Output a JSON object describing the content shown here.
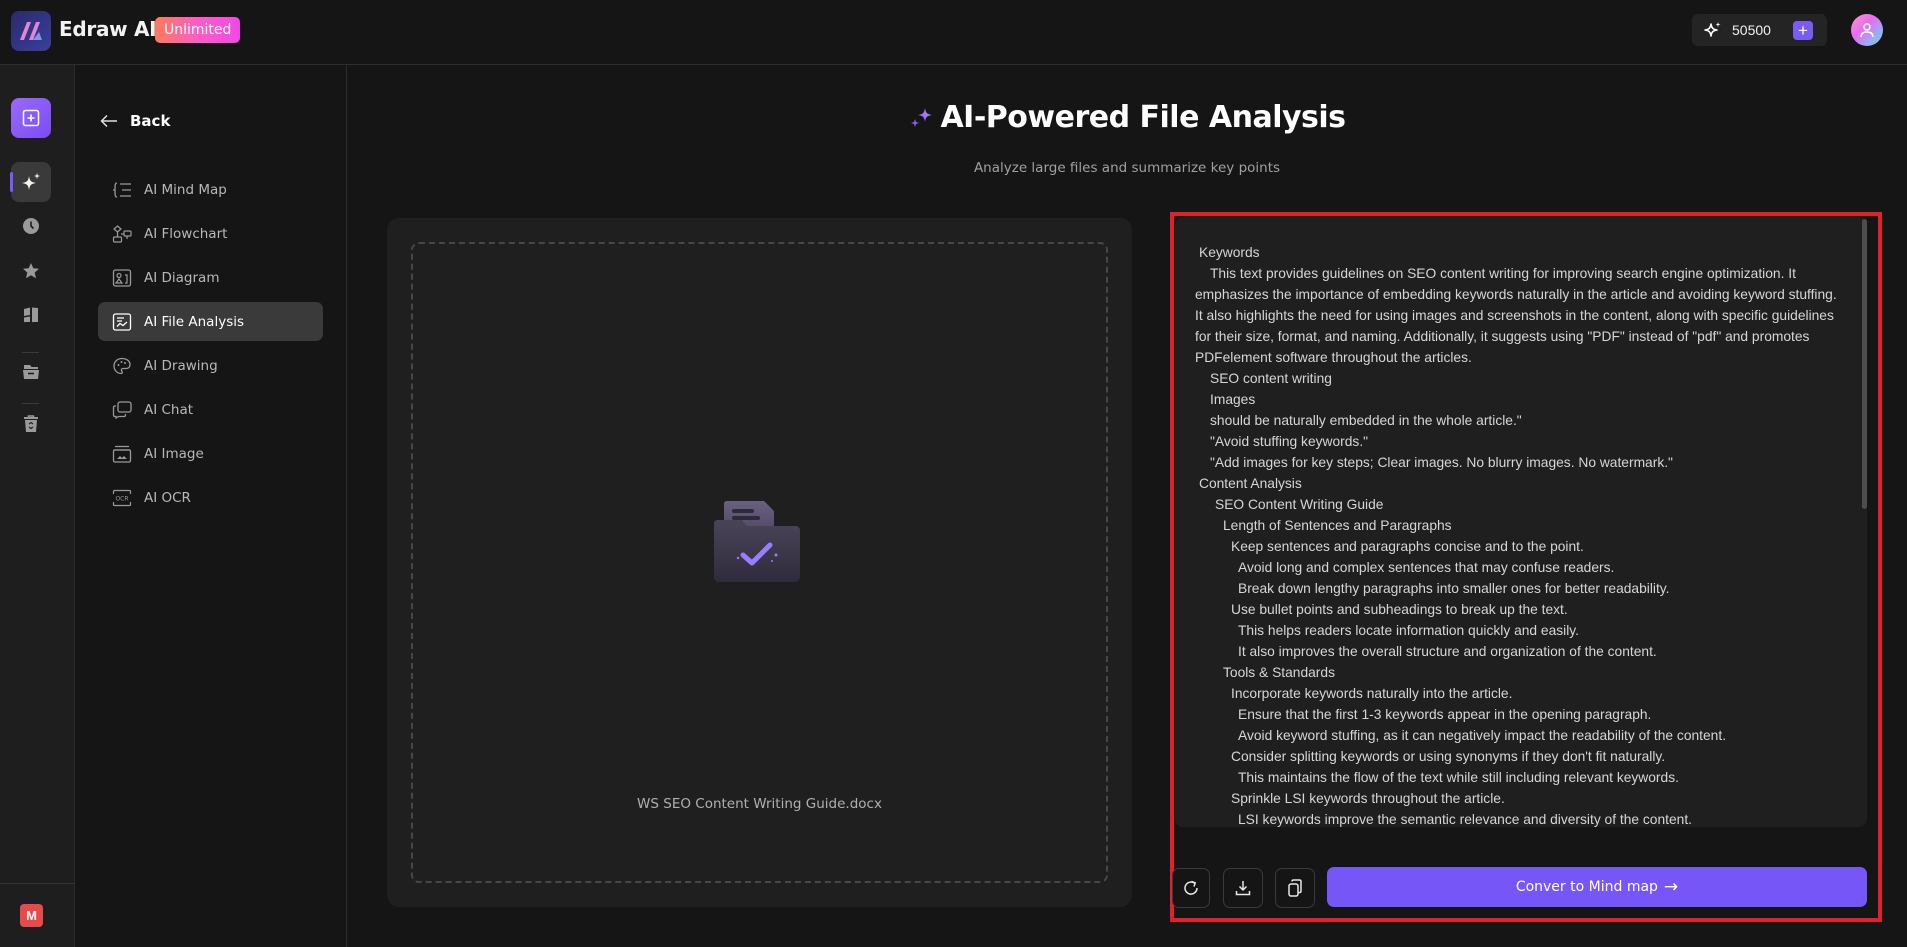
{
  "header": {
    "brand": "Edraw AI",
    "plan_badge": "Unlimited",
    "credits": "50500",
    "add_credits_icon": "plus-icon",
    "avatar_icon": "user-avatar-icon"
  },
  "rail": {
    "items": [
      {
        "name": "new-file",
        "icon": "plus-square-icon"
      },
      {
        "name": "ai",
        "icon": "sparkle-icon",
        "active": true
      },
      {
        "name": "recent",
        "icon": "clock-icon"
      },
      {
        "name": "favorites",
        "icon": "star-icon"
      },
      {
        "name": "templates",
        "icon": "template-icon"
      },
      {
        "name": "files",
        "icon": "folder-icon"
      },
      {
        "name": "trash",
        "icon": "recycle-bin-icon"
      }
    ],
    "workspace_initial": "M"
  },
  "sidebar": {
    "back_label": "Back",
    "items": [
      {
        "label": "AI Mind Map",
        "icon": "mind-map-icon"
      },
      {
        "label": "AI Flowchart",
        "icon": "flowchart-icon"
      },
      {
        "label": "AI Diagram",
        "icon": "diagram-icon"
      },
      {
        "label": "AI File Analysis",
        "icon": "file-analysis-icon",
        "active": true
      },
      {
        "label": "AI Drawing",
        "icon": "palette-icon"
      },
      {
        "label": "AI Chat",
        "icon": "chat-icon"
      },
      {
        "label": "AI Image",
        "icon": "image-icon"
      },
      {
        "label": "AI OCR",
        "icon": "ocr-icon"
      }
    ]
  },
  "main": {
    "title": "AI-Powered File Analysis",
    "subtitle": "Analyze large files and summarize key points",
    "uploaded_file": "WS SEO Content Writing Guide.docx",
    "result_lines": [
      {
        "indent": 1,
        "text": "Keywords"
      },
      {
        "indent": 2,
        "para": true,
        "text": "This text provides guidelines on SEO content writing for improving search engine optimization. It emphasizes the importance of embedding keywords naturally in the article and avoiding keyword stuffing. It also highlights the need for using images and screenshots in the content, along with specific guidelines for their size, format, and naming. Additionally, it suggests using \"PDF\" instead of \"pdf\" and promotes PDFelement software throughout the articles."
      },
      {
        "indent": 2,
        "text": "SEO content writing"
      },
      {
        "indent": 2,
        "text": "Images"
      },
      {
        "indent": 2,
        "text": "should be naturally embedded in the whole article.\""
      },
      {
        "indent": 2,
        "text": "\"Avoid stuffing keywords.\""
      },
      {
        "indent": 2,
        "text": "\"Add images for key steps; Clear images. No blurry images. No watermark.\""
      },
      {
        "indent": 1,
        "text": "Content Analysis"
      },
      {
        "indent": 3,
        "text": "SEO Content Writing Guide"
      },
      {
        "indent": 4,
        "text": "Length of Sentences and Paragraphs"
      },
      {
        "indent": 5,
        "text": "Keep sentences and paragraphs concise and to the point."
      },
      {
        "indent": 6,
        "text": "Avoid long and complex sentences that may confuse readers."
      },
      {
        "indent": 6,
        "text": "Break down lengthy paragraphs into smaller ones for better readability."
      },
      {
        "indent": 5,
        "text": "Use bullet points and subheadings to break up the text."
      },
      {
        "indent": 6,
        "text": "This helps readers locate information quickly and easily."
      },
      {
        "indent": 6,
        "text": "It also improves the overall structure and organization of the content."
      },
      {
        "indent": 4,
        "text": "Tools & Standards"
      },
      {
        "indent": 5,
        "text": "Incorporate keywords naturally into the article."
      },
      {
        "indent": 6,
        "text": "Ensure that the first 1-3 keywords appear in the opening paragraph."
      },
      {
        "indent": 6,
        "text": "Avoid keyword stuffing, as it can negatively impact the readability of the content."
      },
      {
        "indent": 5,
        "text": "Consider splitting keywords or using synonyms if they don't fit naturally."
      },
      {
        "indent": 6,
        "text": "This maintains the flow of the text while still including relevant keywords."
      },
      {
        "indent": 5,
        "text": "Sprinkle LSI keywords throughout the article."
      },
      {
        "indent": 6,
        "text": "LSI keywords improve the semantic relevance and diversity of the content."
      }
    ],
    "actions": {
      "regenerate_icon": "refresh-icon",
      "download_icon": "download-icon",
      "copy_icon": "copy-icon",
      "convert_label": "Conver to Mind map",
      "convert_arrow": "→"
    }
  },
  "colors": {
    "accent": "#7656f7",
    "highlight_frame": "#e0202a",
    "badge_gradient_start": "#ff7a59",
    "badge_gradient_end": "#f048e6"
  }
}
